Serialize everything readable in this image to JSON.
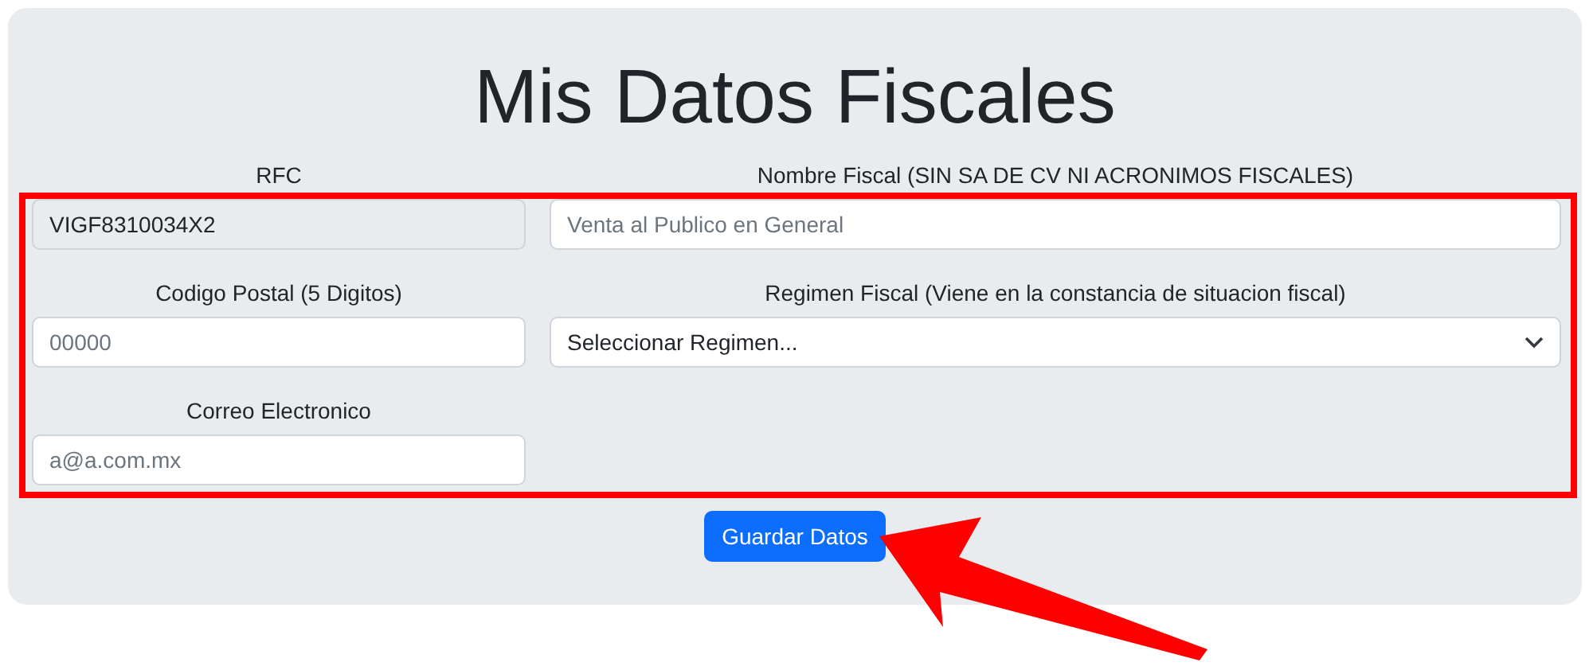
{
  "title": "Mis Datos Fiscales",
  "fields": [
    {
      "kind": "input",
      "label": "RFC",
      "value": "VIGF8310034X2",
      "disabled": true
    },
    {
      "kind": "input",
      "label": "Nombre Fiscal (SIN SA DE CV NI ACRONIMOS FISCALES)",
      "placeholder": "Venta al Publico en General",
      "disabled": false
    },
    {
      "kind": "input",
      "label": "Codigo Postal (5 Digitos)",
      "placeholder": "00000",
      "disabled": false
    },
    {
      "kind": "select",
      "label": "Regimen Fiscal (Viene en la constancia de situacion fiscal)",
      "value": "Seleccionar Regimen..."
    },
    {
      "kind": "input",
      "label": "Correo Electronico",
      "placeholder": "a@a.com.mx",
      "disabled": false
    }
  ],
  "save_button": "Guardar Datos"
}
